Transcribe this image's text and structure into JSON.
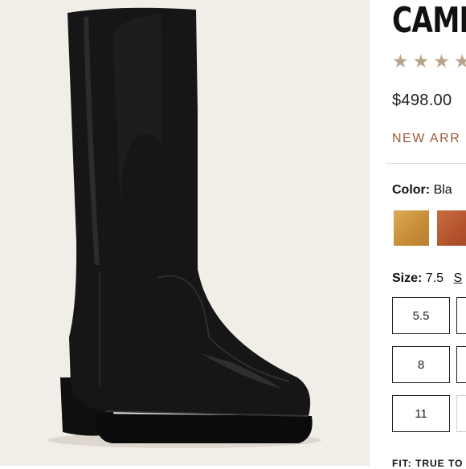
{
  "product": {
    "title": "CAMP",
    "rating_stars": 4,
    "price": "$498.00",
    "badge": "NEW ARR"
  },
  "color": {
    "label": "Color:",
    "selected": "Bla",
    "swatches": [
      {
        "name": "tan",
        "hex": "#d2a04f"
      },
      {
        "name": "cognac",
        "hex": "#b4552e"
      }
    ]
  },
  "size": {
    "label": "Size:",
    "selected": "7.5",
    "guide_link": "S",
    "options": [
      "5.5",
      "8",
      "11"
    ]
  },
  "fit": {
    "label": "FIT: TRUE TO"
  }
}
